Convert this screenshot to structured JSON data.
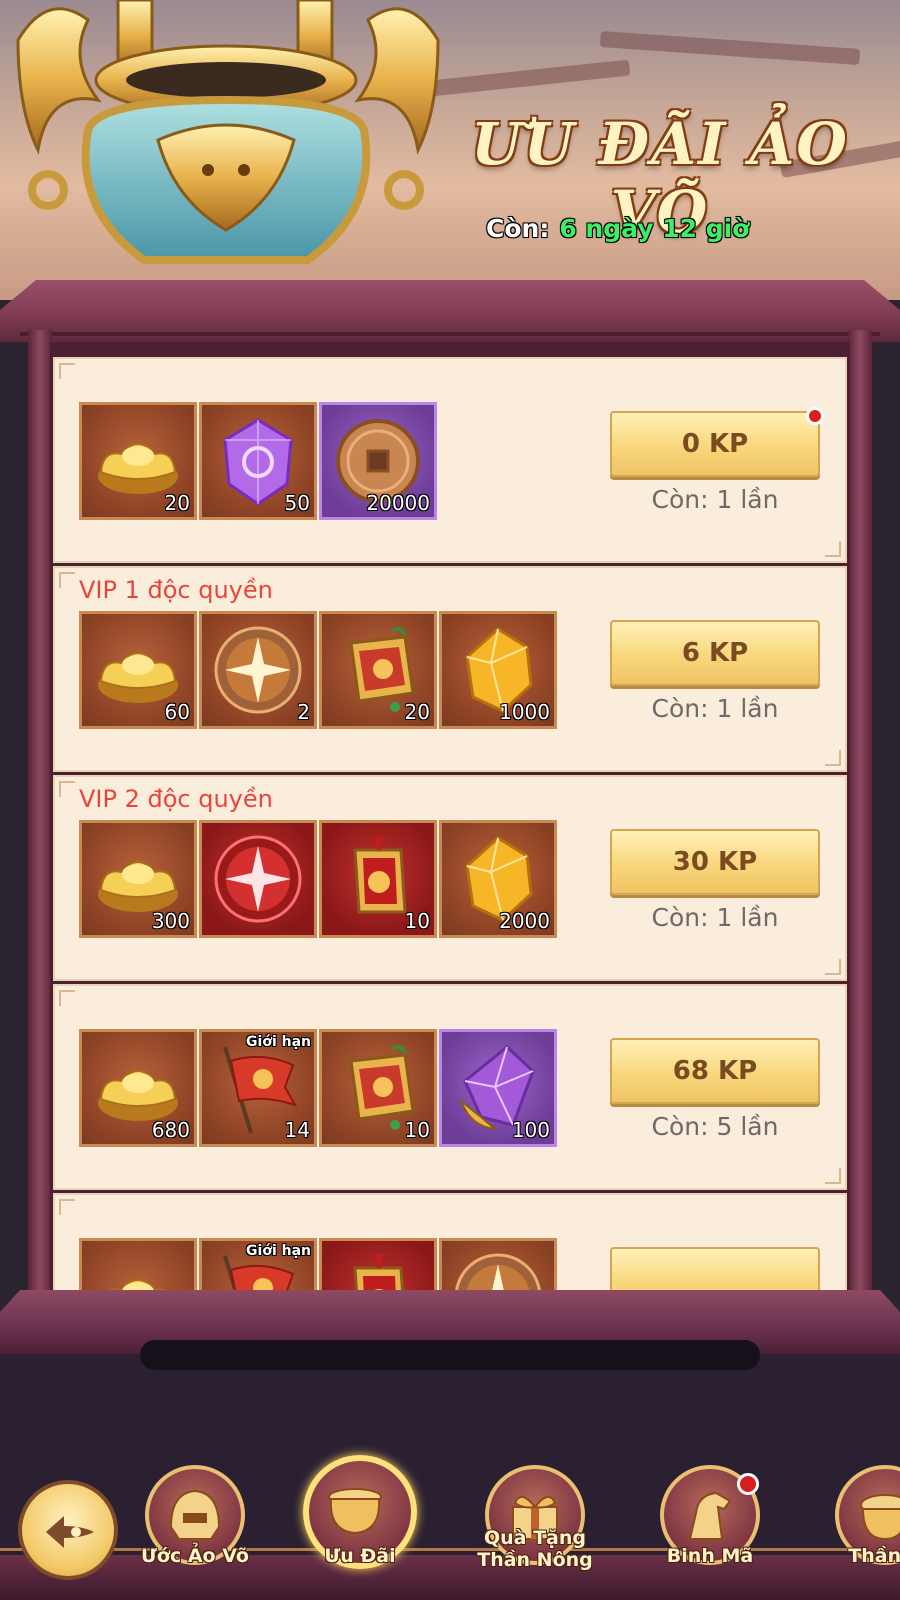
{
  "header": {
    "title": "ƯU ĐÃI ẢO VÕ",
    "timer_label": "Còn:",
    "timer_value": "6 ngày 12 giờ"
  },
  "offers": [
    {
      "vip_label": "",
      "price": "0 KP",
      "remaining": "Còn: 1 lần",
      "has_notification": true,
      "items": [
        {
          "icon": "gold-ingot-icon",
          "qty": "20",
          "frame": "orange"
        },
        {
          "icon": "purple-gem-icon",
          "qty": "50",
          "frame": "orange"
        },
        {
          "icon": "copper-coin-icon",
          "qty": "20000",
          "frame": "purple"
        }
      ]
    },
    {
      "vip_label": "VIP 1 độc quyền",
      "price": "6 KP",
      "remaining": "Còn: 1 lần",
      "has_notification": false,
      "items": [
        {
          "icon": "gold-ingot-icon",
          "qty": "60",
          "frame": "orange"
        },
        {
          "icon": "star-orb-icon",
          "qty": "2",
          "frame": "orange"
        },
        {
          "icon": "token-tablet-icon",
          "qty": "20",
          "frame": "orange"
        },
        {
          "icon": "amber-crystal-icon",
          "qty": "1000",
          "frame": "orange"
        }
      ]
    },
    {
      "vip_label": "VIP 2 độc quyền",
      "price": "30 KP",
      "remaining": "Còn: 1 lần",
      "has_notification": false,
      "items": [
        {
          "icon": "gold-ingot-icon",
          "qty": "300",
          "frame": "orange"
        },
        {
          "icon": "red-star-orb-icon",
          "qty": "",
          "frame": "red"
        },
        {
          "icon": "red-token-tablet-icon",
          "qty": "10",
          "frame": "red"
        },
        {
          "icon": "amber-crystal-icon",
          "qty": "2000",
          "frame": "orange"
        }
      ]
    },
    {
      "vip_label": "",
      "price": "68 KP",
      "remaining": "Còn: 5 lần",
      "has_notification": false,
      "items": [
        {
          "icon": "gold-ingot-icon",
          "qty": "680",
          "frame": "orange"
        },
        {
          "icon": "war-banner-icon",
          "qty": "14",
          "frame": "orange",
          "badge": "Giới hạn"
        },
        {
          "icon": "token-tablet-icon",
          "qty": "10",
          "frame": "orange"
        },
        {
          "icon": "purple-crystal-icon",
          "qty": "100",
          "frame": "purple"
        }
      ]
    },
    {
      "vip_label": "",
      "price": "",
      "remaining": "",
      "has_notification": false,
      "items": [
        {
          "icon": "gold-ingot-icon",
          "qty": "",
          "frame": "orange"
        },
        {
          "icon": "war-banner-icon",
          "qty": "",
          "frame": "orange",
          "badge": "Giới hạn"
        },
        {
          "icon": "red-token-tablet-icon",
          "qty": "",
          "frame": "red"
        },
        {
          "icon": "star-orb-icon",
          "qty": "",
          "frame": "orange"
        }
      ]
    }
  ],
  "nav": {
    "back_icon": "back-arrow-icon",
    "items": [
      {
        "label": "Ước Ảo Võ",
        "icon": "helmet-icon",
        "active": false,
        "dot": false
      },
      {
        "label": "Ưu Đãi",
        "icon": "cauldron-icon",
        "active": true,
        "dot": false
      },
      {
        "label": "Quà Tặng Thần Nông",
        "icon": "gift-icon",
        "active": false,
        "dot": false
      },
      {
        "label": "Binh Mã",
        "icon": "horse-icon",
        "active": false,
        "dot": true
      },
      {
        "label": "Thần C",
        "icon": "pot-icon",
        "active": false,
        "dot": false
      }
    ]
  },
  "colors": {
    "vip_text": "#e8463a",
    "timer_value": "#3af064",
    "card_bg": "#fbeddc",
    "frame": "#7e3a52",
    "button": "#f8d77c"
  }
}
